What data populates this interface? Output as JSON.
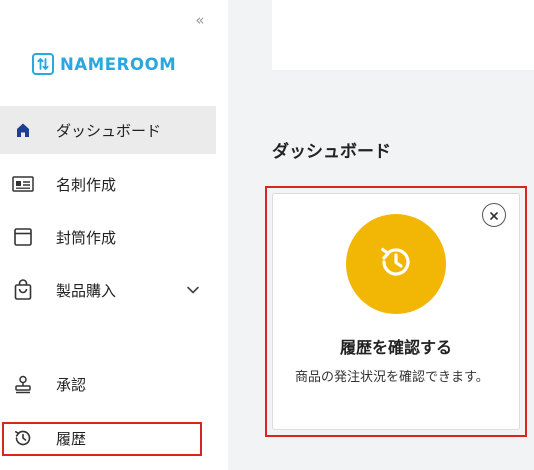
{
  "sidebar": {
    "collapse_label": "«",
    "logo": {
      "text": "NAMEROOM",
      "color": "#29a8df"
    },
    "items": [
      {
        "label": "ダッシュボード",
        "icon": "home-icon",
        "active": true
      },
      {
        "label": "名刺作成",
        "icon": "id-card-icon"
      },
      {
        "label": "封筒作成",
        "icon": "envelope-icon"
      },
      {
        "label": "製品購入",
        "icon": "shopping-bag-icon",
        "has_submenu": true
      },
      {
        "label": "承認",
        "icon": "stamp-icon"
      },
      {
        "label": "履歴",
        "icon": "history-icon"
      }
    ]
  },
  "main": {
    "page_title": "ダッシュボード",
    "card": {
      "title": "履歴を確認する",
      "description": "商品の発注状況を確認できます。",
      "icon": "history-icon",
      "icon_bg": "#f2b705"
    }
  },
  "colors": {
    "highlight": "#d9251d",
    "active_bg": "#ebebeb",
    "content_bg": "#f2f3f5"
  }
}
